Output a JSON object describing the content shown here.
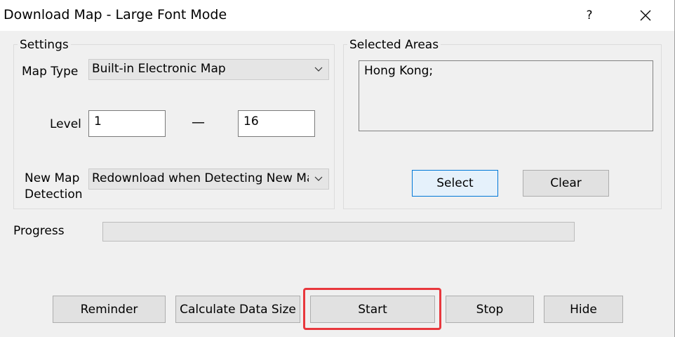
{
  "window": {
    "title": "Download Map - Large Font Mode",
    "help_label": "?",
    "close_icon": "close-icon"
  },
  "settings": {
    "group_title": "Settings",
    "map_type_label": "Map Type",
    "map_type_value": "Built-in Electronic Map",
    "level_label": "Level",
    "level_from": "1",
    "level_separator": "—",
    "level_to": "16",
    "detection_label_line1": "New Map",
    "detection_label_line2": "Detection",
    "detection_value": "Redownload when Detecting New Maps"
  },
  "selected_areas": {
    "group_title": "Selected Areas",
    "list_text": "Hong Kong;",
    "select_label": "Select",
    "clear_label": "Clear"
  },
  "progress": {
    "label": "Progress",
    "value": 0
  },
  "bottom_buttons": {
    "reminder": "Reminder",
    "calculate": "Calculate Data Size",
    "start": "Start",
    "stop": "Stop",
    "hide": "Hide"
  },
  "highlight": {
    "color": "#e8383d",
    "target": "start-button"
  }
}
